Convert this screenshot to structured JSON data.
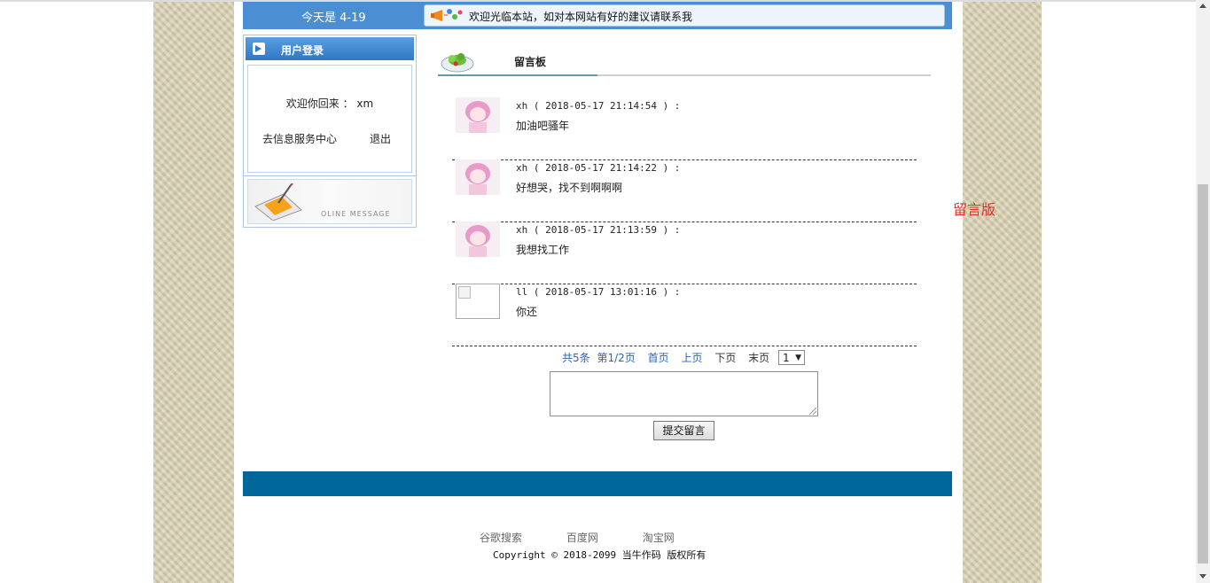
{
  "header": {
    "date": "今天是 4-19",
    "notice": "欢迎光临本站，如对本网站有好的建议请联系我"
  },
  "sidebar": {
    "login_title": "用户登录",
    "welcome": "欢迎你回来 ： xm",
    "service_link": "去信息服务中心",
    "logout_link": "退出",
    "banner_text": "OLINE MESSAGE"
  },
  "board": {
    "title": "留言板",
    "messages": [
      {
        "user": "xh",
        "time": "2018-05-17 21:14:54",
        "text": "加油吧骚年",
        "avatar": "anime-girl-avatar"
      },
      {
        "user": "xh",
        "time": "2018-05-17 21:14:22",
        "text": "好想哭，找不到啊啊啊",
        "avatar": "anime-girl-avatar"
      },
      {
        "user": "xh",
        "time": "2018-05-17 21:13:59",
        "text": "我想找工作",
        "avatar": "anime-girl-avatar"
      },
      {
        "user": "ll",
        "time": "2018-05-17 13:01:16",
        "text": "你还",
        "avatar": "broken-image"
      }
    ],
    "meta_format": "{user} ( {time} ) :",
    "meta": [
      "xh ( 2018-05-17 21:14:54 ) :",
      "xh ( 2018-05-17 21:14:22 ) :",
      "xh ( 2018-05-17 21:13:59 ) :",
      "ll ( 2018-05-17 13:01:16 ) :"
    ]
  },
  "pager": {
    "total": "共5条",
    "page_info": "第1/2页",
    "first": "首页",
    "prev": "上页",
    "next": "下页",
    "last": "末页",
    "selected_page": "1"
  },
  "form": {
    "submit_label": "提交留言",
    "textarea_value": ""
  },
  "footer": {
    "links": [
      "谷歌搜索",
      "百度网",
      "淘宝网"
    ],
    "copyright": "Copyright © 2018-2099 当牛作码 版权所有"
  },
  "side_label": "留言版",
  "colors": {
    "header_blue": "#4b8fd2",
    "footer_bar": "#006899",
    "link_blue": "#2a65b5",
    "side_label_red": "#e0302a",
    "background_pattern": "#d9d0b0"
  }
}
